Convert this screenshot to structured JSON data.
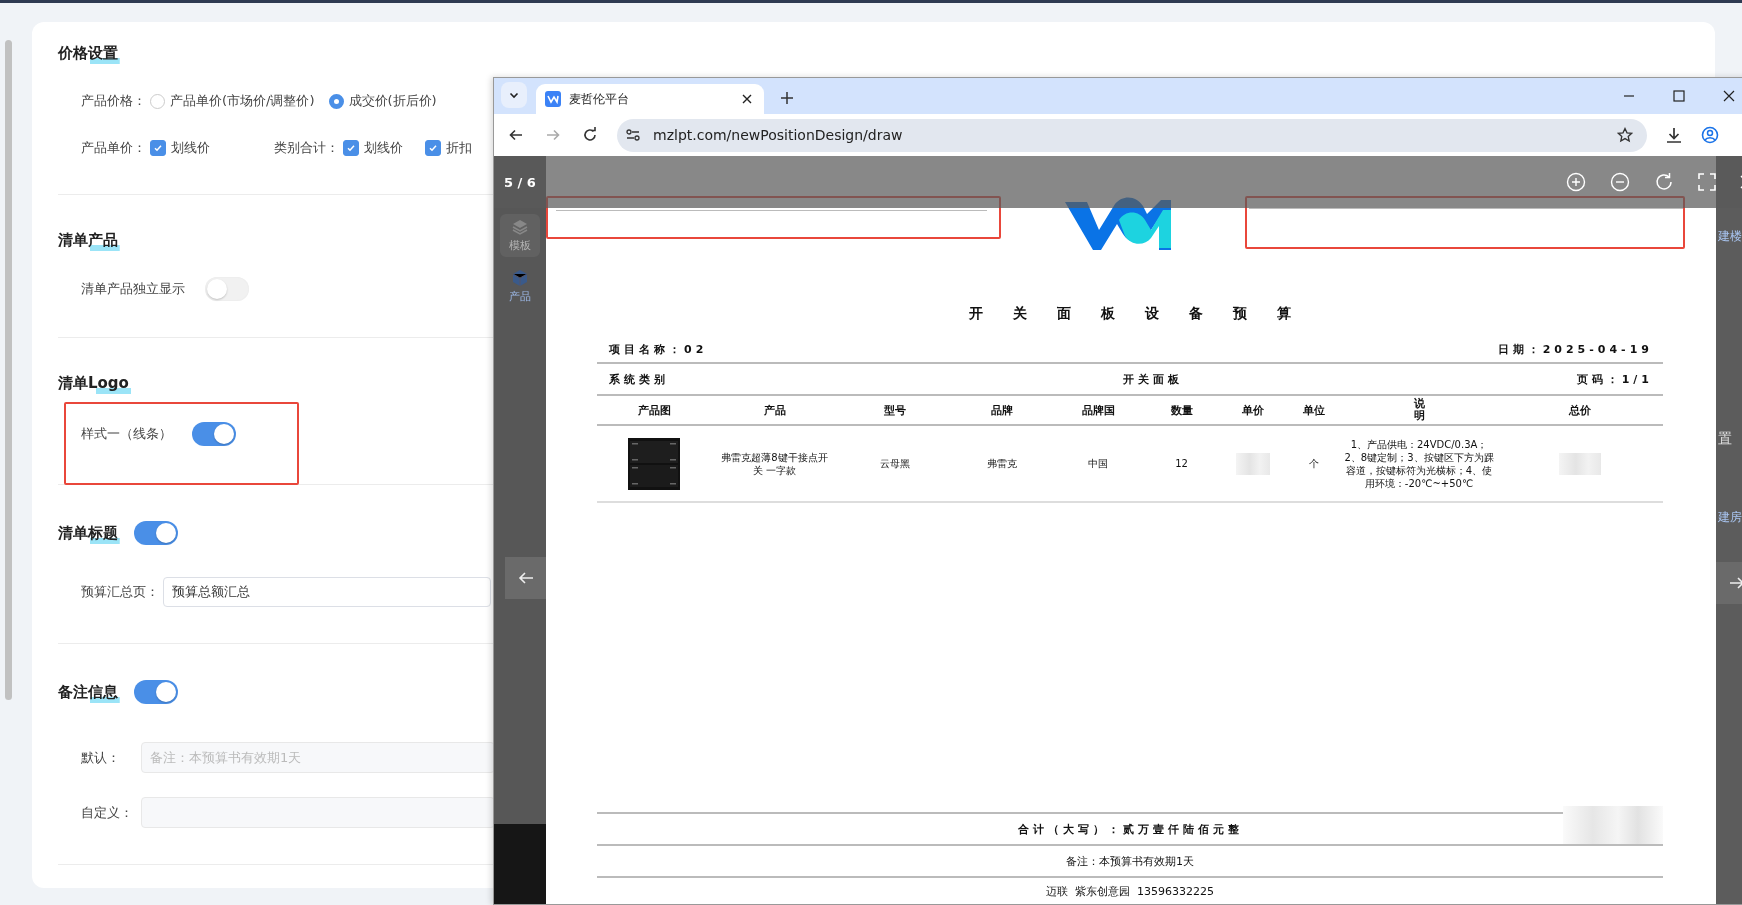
{
  "settings": {
    "price": {
      "title": "价格设置",
      "product_price": {
        "label": "产品价格：",
        "options": [
          {
            "label": "产品单价(市场价/调整价)",
            "selected": false
          },
          {
            "label": "成交价(折后价)",
            "selected": true
          }
        ]
      },
      "unit_price": {
        "label": "产品单价：",
        "options": [
          {
            "label": "划线价",
            "checked": true
          }
        ]
      },
      "category_total": {
        "label": "类别合计：",
        "options": [
          {
            "label": "划线价",
            "checked": true
          },
          {
            "label": "折扣",
            "checked": true
          }
        ]
      }
    },
    "list_products": {
      "title": "清单产品",
      "independent": {
        "label": "清单产品独立显示",
        "on": false
      }
    },
    "list_logo": {
      "title": "清单Logo",
      "style": {
        "label": "样式一（线条）",
        "on": true
      }
    },
    "list_title": {
      "title": "清单标题",
      "on": true,
      "summary": {
        "label": "预算汇总页：",
        "value": "预算总额汇总"
      }
    },
    "remarks": {
      "title": "备注信息",
      "on": true,
      "default": {
        "label": "默认：",
        "placeholder": "备注：本预算书有效期1天"
      },
      "custom": {
        "label": "自定义："
      }
    }
  },
  "browser": {
    "tab": {
      "title": "麦哲伦平台"
    },
    "address": "mzlpt.com/newPositionDesign/draw",
    "viewer": {
      "counter": "5 / 6"
    },
    "background_app": {
      "sidebar": [
        {
          "label": "模板"
        },
        {
          "label": "产品"
        }
      ],
      "right_texts": [
        "建楼",
        "置",
        "建房"
      ]
    },
    "document": {
      "title": "开关面板设备预算",
      "project": "项目名称：02",
      "date": "日期：2025-04-19",
      "category_label": "系统类别",
      "category": "开关面板",
      "page": "页码：1/1",
      "columns": [
        "产品图",
        "产品",
        "型号",
        "品牌",
        "品牌国",
        "数量",
        "单价",
        "单位",
        "说明",
        "总价"
      ],
      "rows": [
        {
          "product": "弗雷克超薄8键干接点开关 一字款",
          "model": "云母黑",
          "brand": "弗雷克",
          "country": "中国",
          "quantity": "12",
          "unit": "个",
          "description": "1、产品供电：24VDC/0.3A；2、8键定制；3、按键区下方为踝容道，按键标符为光横标；4、使用环境：-20℃~+50℃"
        }
      ],
      "total": "合计（大写）：贰万壹仟陆佰元整",
      "remark": "备注：本预算书有效期1天",
      "contact": "迈联  紫东创意园  13596332225"
    }
  }
}
